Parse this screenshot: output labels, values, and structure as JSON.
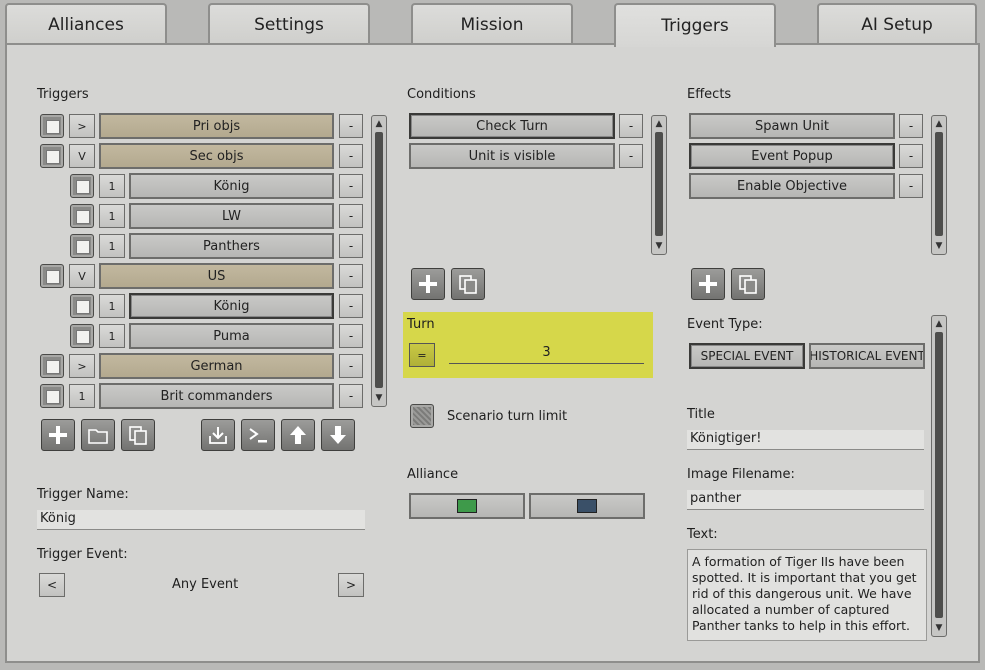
{
  "tabs": [
    "Alliances",
    "Settings",
    "Mission",
    "Triggers",
    "AI Setup"
  ],
  "triggers": {
    "label": "Triggers",
    "rows": [
      {
        "toggle": ">",
        "name": "Pri objs",
        "tan": true
      },
      {
        "toggle": "V",
        "name": "Sec objs",
        "tan": true
      },
      {
        "toggle": "1",
        "name": "König",
        "tan": false
      },
      {
        "toggle": "1",
        "name": "LW",
        "tan": false
      },
      {
        "toggle": "1",
        "name": "Panthers",
        "tan": false
      },
      {
        "toggle": "V",
        "name": "US",
        "tan": true
      },
      {
        "toggle": "1",
        "name": "König",
        "tan": false
      },
      {
        "toggle": "1",
        "name": "Puma",
        "tan": false
      },
      {
        "toggle": ">",
        "name": "German",
        "tan": true
      },
      {
        "toggle": "1",
        "name": "Brit commanders",
        "tan": false
      }
    ],
    "minus": "-",
    "name_label": "Trigger Name:",
    "name_value": "König",
    "event_label": "Trigger Event:",
    "event_value": "Any Event",
    "prev": "<",
    "next": ">"
  },
  "conditions": {
    "label": "Conditions",
    "items": [
      "Check Turn",
      "Unit is visible"
    ],
    "turn_label": "Turn",
    "turn_op": "=",
    "turn_value": "3",
    "scenario_limit": "Scenario turn limit",
    "alliance_label": "Alliance",
    "alliance_colors": [
      "#3e9a4a",
      "#3a5068"
    ]
  },
  "effects": {
    "label": "Effects",
    "items": [
      "Spawn Unit",
      "Event Popup",
      "Enable Objective"
    ],
    "event_type_label": "Event Type:",
    "event_types": [
      "SPECIAL EVENT",
      "HISTORICAL EVENT"
    ],
    "title_label": "Title",
    "title_value": "Königtiger!",
    "image_label": "Image Filename:",
    "image_value": "panther",
    "text_label": "Text:",
    "text_value": "A formation of Tiger IIs have been spotted. It is important that you get rid of this dangerous unit. We have allocated a number of captured Panther tanks to help in this effort."
  },
  "accent_highlight": "#d6d74a"
}
